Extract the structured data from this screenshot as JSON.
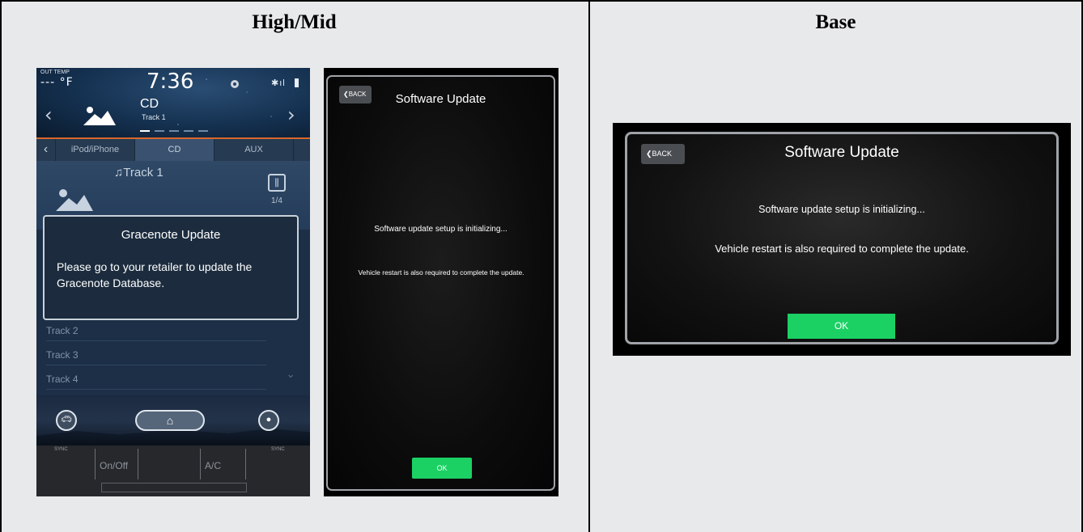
{
  "columns": {
    "left_header": "High/Mid",
    "right_header": "Base"
  },
  "audio_screen": {
    "status": {
      "out_temp_label": "OUT TEMP",
      "out_temp_value": "--- °F",
      "clock": "7:36"
    },
    "source": {
      "title": "CD",
      "track": "Track 1"
    },
    "tabs": [
      "iPod/iPhone",
      "CD",
      "AUX"
    ],
    "selected_tab": "CD",
    "now_playing": {
      "track": "♫Track 1",
      "count": "1/4"
    },
    "list": [
      "Track 2",
      "Track 3",
      "Track 4"
    ],
    "popup": {
      "title": "Gracenote Update",
      "message": "Please go to your retailer to update the Gracenote Database."
    },
    "bottom_bar": {
      "icons": [
        "car-icon",
        "home-icon",
        "profile-icon"
      ]
    },
    "climate": {
      "sync_left": "SYNC",
      "sync_right": "SYNC",
      "on_off": "On/Off",
      "ac": "A/C"
    }
  },
  "portrait_update": {
    "back_label": "BACK",
    "title": "Software Update",
    "message1": "Software update setup is initializing...",
    "message2": "Vehicle restart is also required to complete the update.",
    "ok_label": "OK",
    "ok_color": "#1bd164"
  },
  "landscape_update": {
    "back_label": "BACK",
    "title": "Software Update",
    "message1": "Software update setup is initializing...",
    "message2": "Vehicle restart is also required to complete the update.",
    "ok_label": "OK",
    "ok_color": "#1bd164"
  }
}
